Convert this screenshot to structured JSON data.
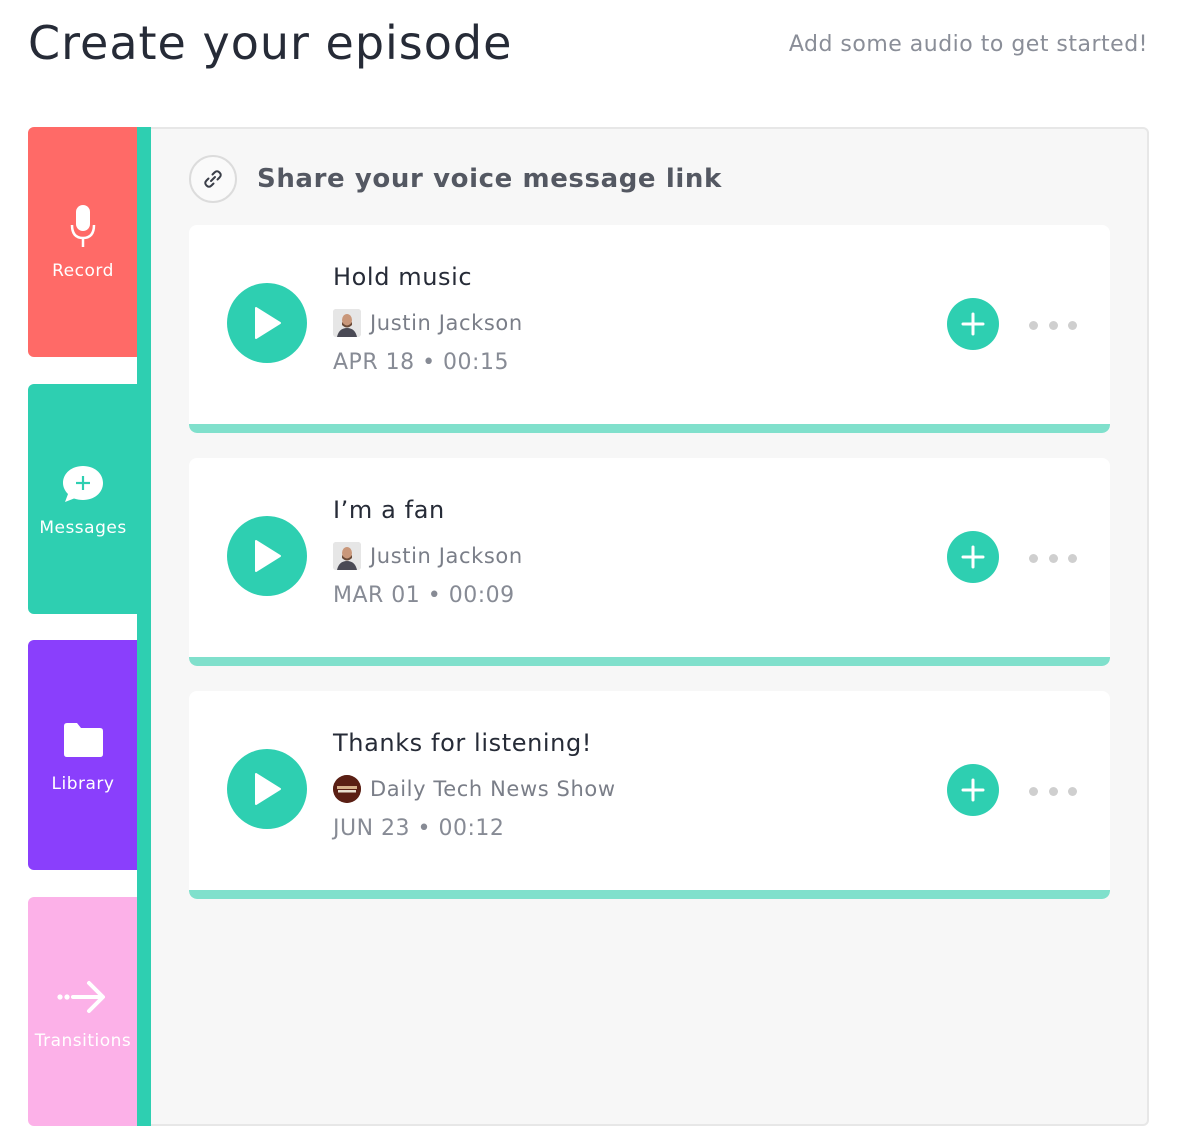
{
  "header": {
    "title": "Create your episode",
    "subtitle": "Add some audio to get started!"
  },
  "tabs": [
    {
      "label": "Record",
      "icon": "microphone-icon",
      "color": "#ff6a67"
    },
    {
      "label": "Messages",
      "icon": "chat-bubble-plus-icon",
      "color": "#2ecfb1"
    },
    {
      "label": "Library",
      "icon": "folder-icon",
      "color": "#8a3ffc"
    },
    {
      "label": "Transitions",
      "icon": "arrow-right-icon",
      "color": "#fcb1e8"
    }
  ],
  "panel": {
    "share_label": "Share your voice message link",
    "share_icon": "link-icon"
  },
  "messages": [
    {
      "title": "Hold music",
      "author": "Justin Jackson",
      "meta": "APR 18 • 00:15"
    },
    {
      "title": "I’m a fan",
      "author": "Justin Jackson",
      "meta": "MAR 01 • 00:09"
    },
    {
      "title": "Thanks for listening!",
      "author": "Daily Tech News Show",
      "meta": "JUN 23 • 00:12"
    }
  ],
  "colors": {
    "accent": "#2ecfb1",
    "strip": "#80e0cc",
    "record": "#ff6a67",
    "library": "#8a3ffc",
    "transitions": "#fcb1e8"
  }
}
